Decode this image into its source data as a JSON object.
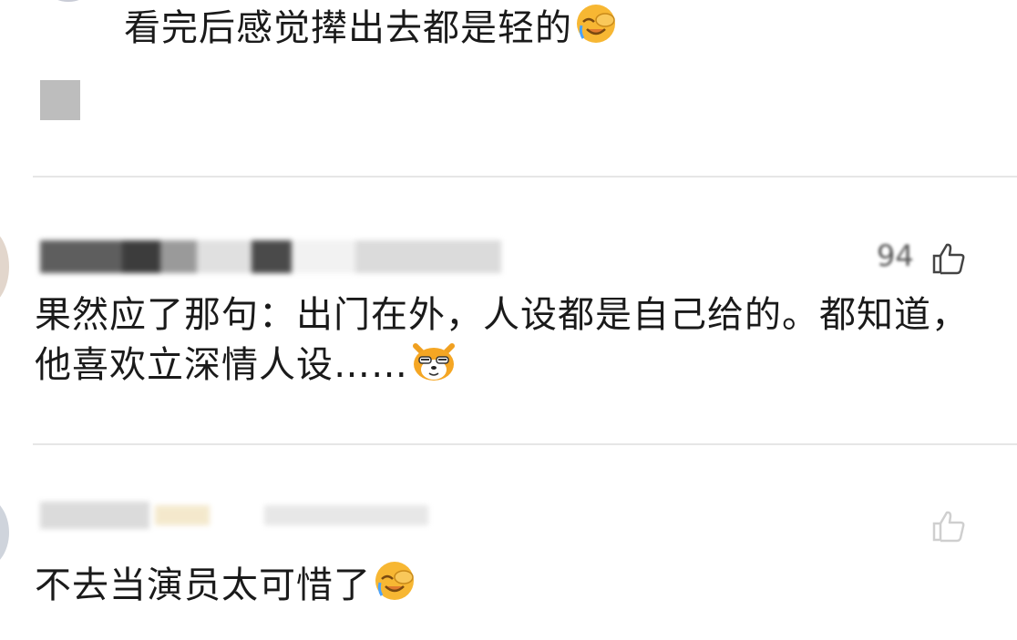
{
  "comments": [
    {
      "text": "看完后感觉撵出去都是轻的",
      "emoji": "facepalm-emoji",
      "has_image": true
    },
    {
      "username": "",
      "likes": "94",
      "text": "果然应了那句：出门在外，人设都是自己给的。都知道，他喜欢立深情人设……",
      "emoji": "cat-emoji"
    },
    {
      "username": "",
      "text": "不去当演员太可惜了",
      "emoji": "facepalm-emoji"
    }
  ],
  "icons": {
    "like": "thumbs-up-icon"
  },
  "colors": {
    "text": "#1a1a1a",
    "divider": "#e6e6e6",
    "muted": "#555555",
    "emoji_face": "#f7b733"
  }
}
